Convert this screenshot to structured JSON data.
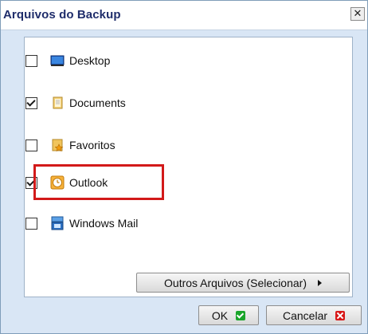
{
  "dialog": {
    "title": "Arquivos do Backup",
    "close_glyph": "✕"
  },
  "items": [
    {
      "label": "Desktop",
      "checked": false,
      "icon": "desktop-icon"
    },
    {
      "label": "Documents",
      "checked": true,
      "icon": "documents-folder-icon"
    },
    {
      "label": "Favoritos",
      "checked": false,
      "icon": "favorites-folder-icon"
    },
    {
      "label": "Outlook",
      "checked": true,
      "icon": "outlook-clock-icon"
    },
    {
      "label": "Windows Mail",
      "checked": false,
      "icon": "windows-mail-icon"
    }
  ],
  "buttons": {
    "other_files": "Outros Arquivos (Selecionar)",
    "ok": "OK",
    "cancel": "Cancelar"
  },
  "colors": {
    "highlight": "#d21a1a",
    "ok_icon": "#1aa52a",
    "cancel_icon": "#d81818"
  }
}
